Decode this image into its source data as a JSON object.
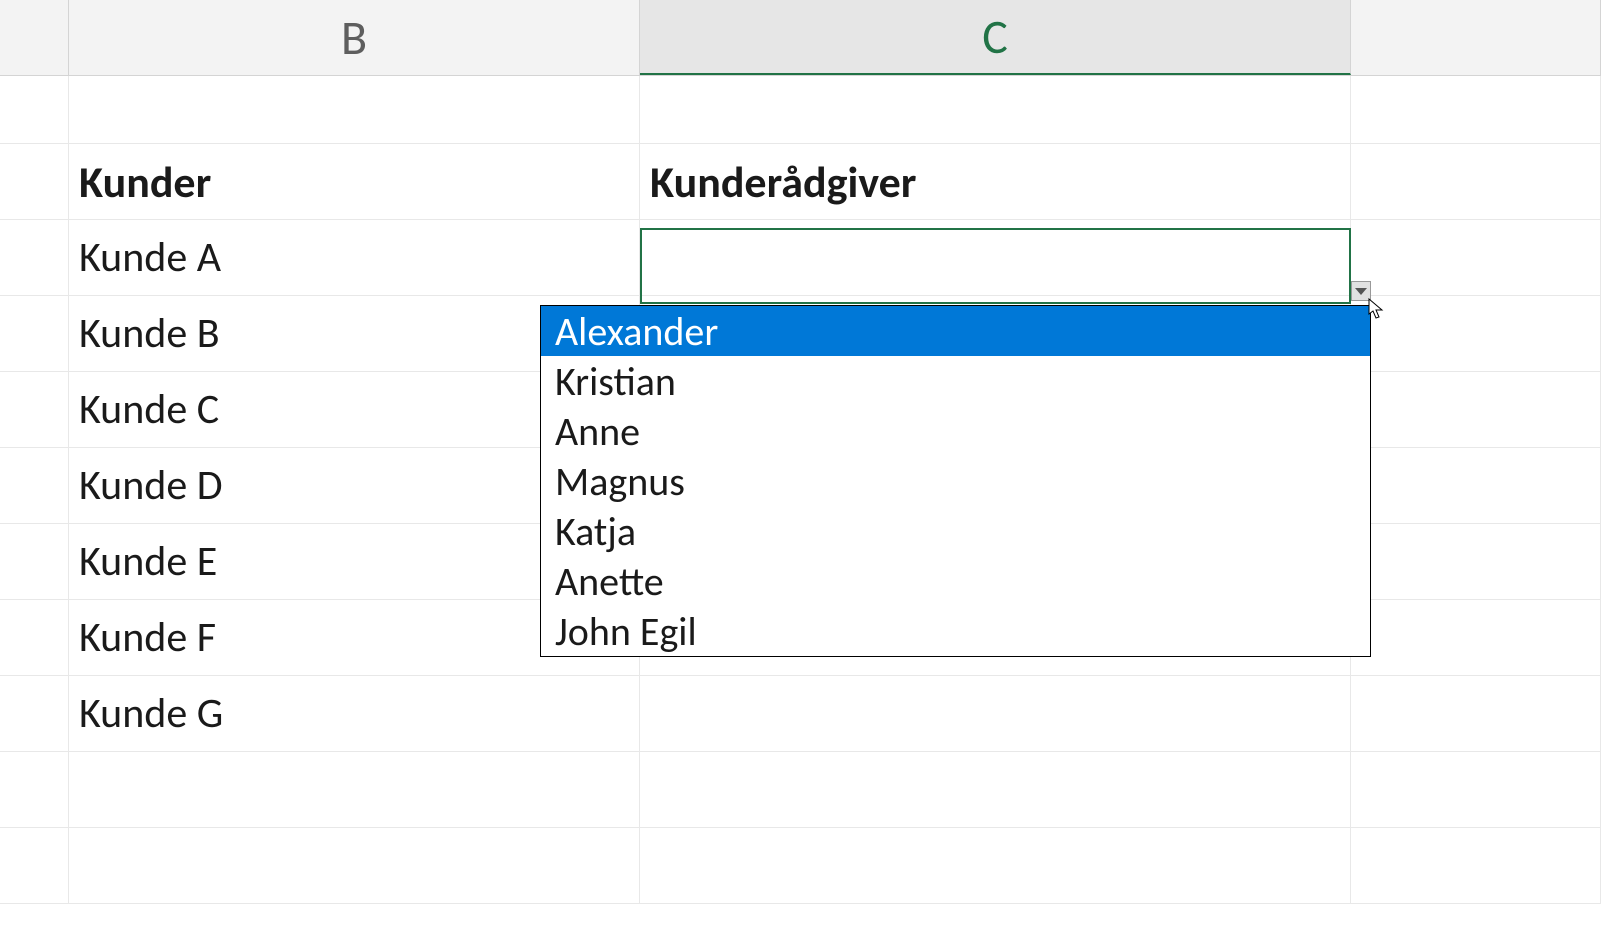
{
  "columns": {
    "b": "B",
    "c": "C"
  },
  "headers": {
    "col_b": "Kunder",
    "col_c": "Kunderådgiver"
  },
  "customers": [
    "Kunde A",
    "Kunde B",
    "Kunde C",
    "Kunde D",
    "Kunde E",
    "Kunde F",
    "Kunde G"
  ],
  "dropdown": {
    "selected_value": "",
    "options": [
      "Alexander",
      "Kristian",
      "Anne",
      "Magnus",
      "Katja",
      "Anette",
      "John Egil"
    ],
    "highlighted_index": 0
  }
}
